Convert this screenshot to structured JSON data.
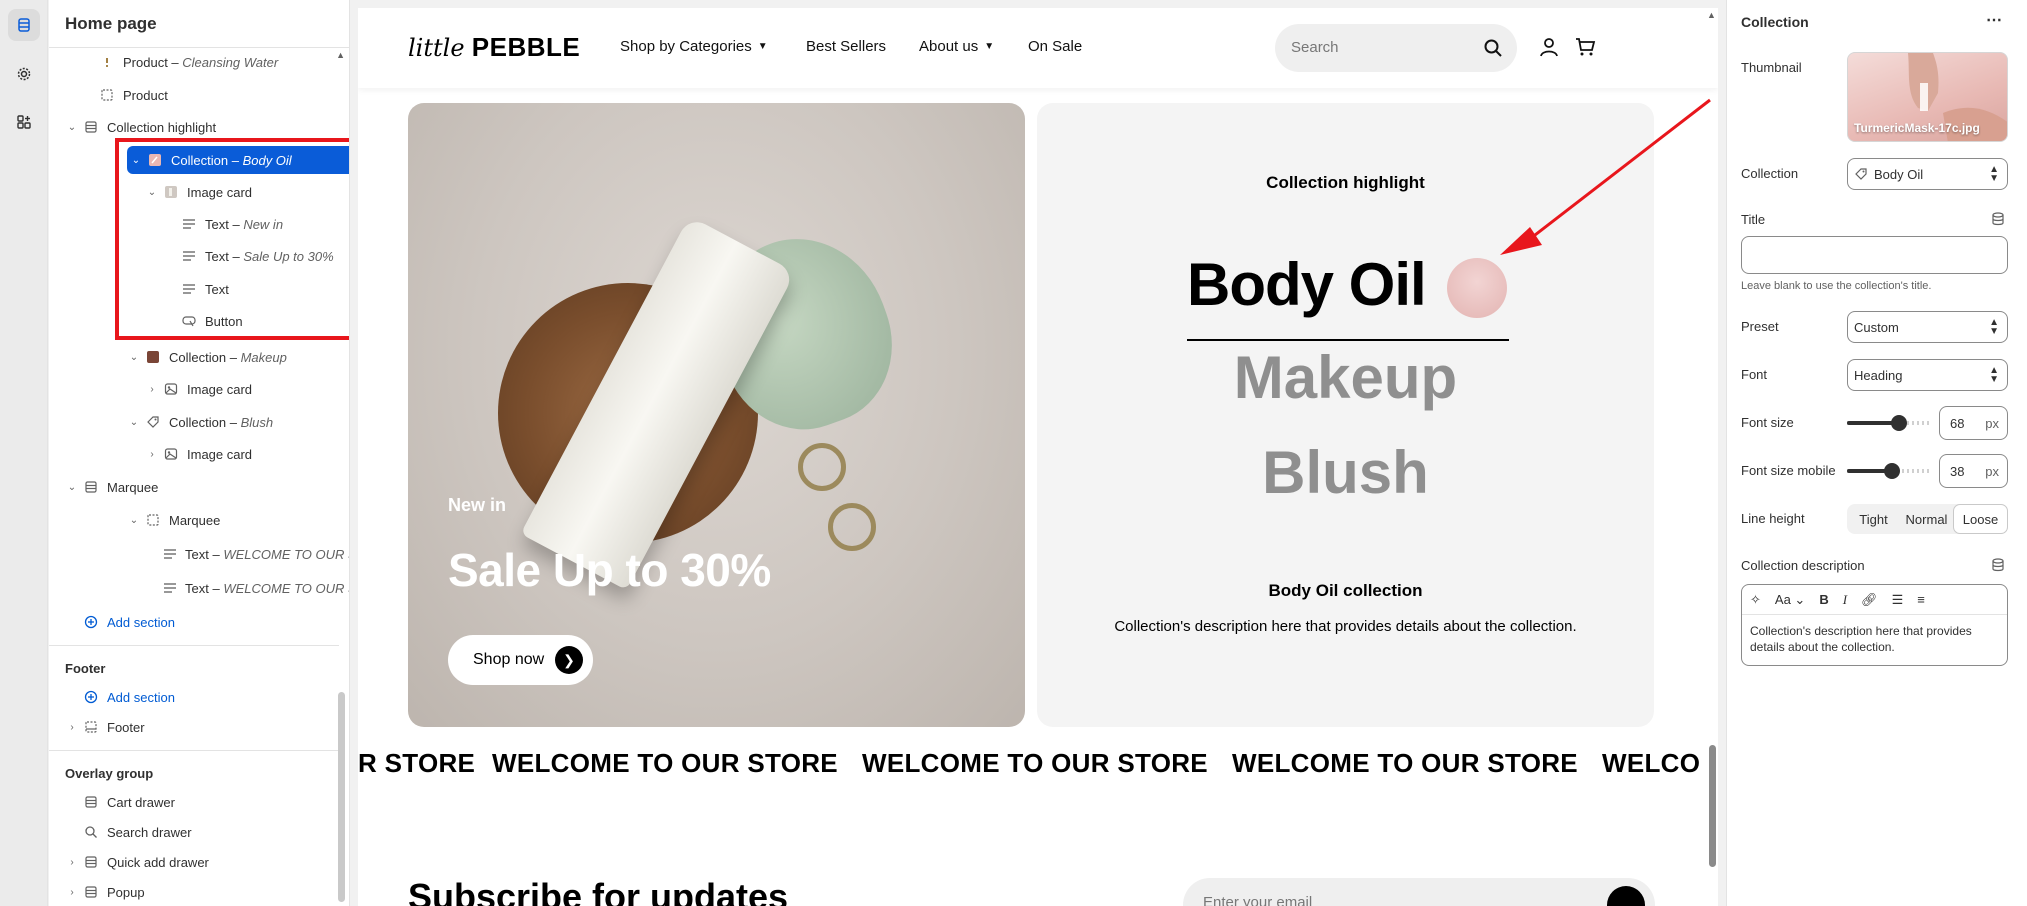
{
  "sidebar": {
    "title": "Home page",
    "items": [
      {
        "label": "Product",
        "sub": "Cleansing Water"
      },
      {
        "label": "Product",
        "sub": ""
      },
      {
        "label": "Collection highlight",
        "sub": ""
      },
      {
        "label": "Collection",
        "sub": "Body Oil"
      },
      {
        "label": "Image card",
        "sub": ""
      },
      {
        "label": "Text",
        "sub": "New in"
      },
      {
        "label": "Text",
        "sub": "Sale Up to 30%"
      },
      {
        "label": "Text",
        "sub": ""
      },
      {
        "label": "Button",
        "sub": ""
      },
      {
        "label": "Collection",
        "sub": "Makeup"
      },
      {
        "label": "Image card",
        "sub": ""
      },
      {
        "label": "Collection",
        "sub": "Blush"
      },
      {
        "label": "Image card",
        "sub": ""
      },
      {
        "label": "Marquee",
        "sub": ""
      },
      {
        "label": "Marquee",
        "sub": ""
      },
      {
        "label": "Text",
        "sub": "WELCOME TO OUR ST..."
      },
      {
        "label": "Text",
        "sub": "WELCOME TO OUR ST..."
      }
    ],
    "add_section": "Add section",
    "footer_group": "Footer",
    "footer_add": "Add section",
    "footer_item": "Footer",
    "overlay_group": "Overlay group",
    "overlay_items": [
      "Cart drawer",
      "Search drawer",
      "Quick add drawer",
      "Popup"
    ]
  },
  "store": {
    "logo_script": "little",
    "logo_word": "PEBBLE",
    "nav": [
      "Shop by Categories",
      "Best Sellers",
      "About us",
      "On Sale"
    ],
    "search_placeholder": "Search",
    "hero_small": "New in",
    "hero_big": "Sale Up to 30%",
    "shop_now": "Shop now",
    "ch_eyebrow": "Collection highlight",
    "ch_active": "Body Oil",
    "ch_inactive": [
      "Makeup",
      "Blush"
    ],
    "ch_name": "Body Oil collection",
    "ch_desc": "Collection's description here that provides details about the collection.",
    "marquee": [
      "R STORE",
      "WELCOME TO OUR STORE",
      "WELCOME TO OUR STORE",
      "WELCOME TO OUR STORE",
      "WELCO"
    ],
    "subscribe_title": "Subscribe for updates",
    "email_placeholder": "Enter your email"
  },
  "panel": {
    "title": "Collection",
    "more": "⋯",
    "thumbnail_label": "Thumbnail",
    "thumbnail_file": "TurmericMask-17c.jpg",
    "collection_label": "Collection",
    "collection_value": "Body Oil",
    "title_label": "Title",
    "title_value": "",
    "title_help": "Leave blank to use the collection's title.",
    "preset_label": "Preset",
    "preset_value": "Custom",
    "font_label": "Font",
    "font_value": "Heading",
    "font_size_label": "Font size",
    "font_size_value": "68",
    "font_size_mobile_label": "Font size mobile",
    "font_size_mobile_value": "38",
    "unit": "px",
    "line_height_label": "Line height",
    "line_height_options": [
      "Tight",
      "Normal",
      "Loose"
    ],
    "line_height_selected": "Loose",
    "desc_label": "Collection description",
    "desc_value": "Collection's description here that provides details about the collection.",
    "font_size_fraction": 0.62,
    "font_size_mobile_fraction": 0.53
  },
  "colors": {
    "selected": "#0a5cd8",
    "highlight": "#e8161c",
    "link": "#005bd3"
  }
}
